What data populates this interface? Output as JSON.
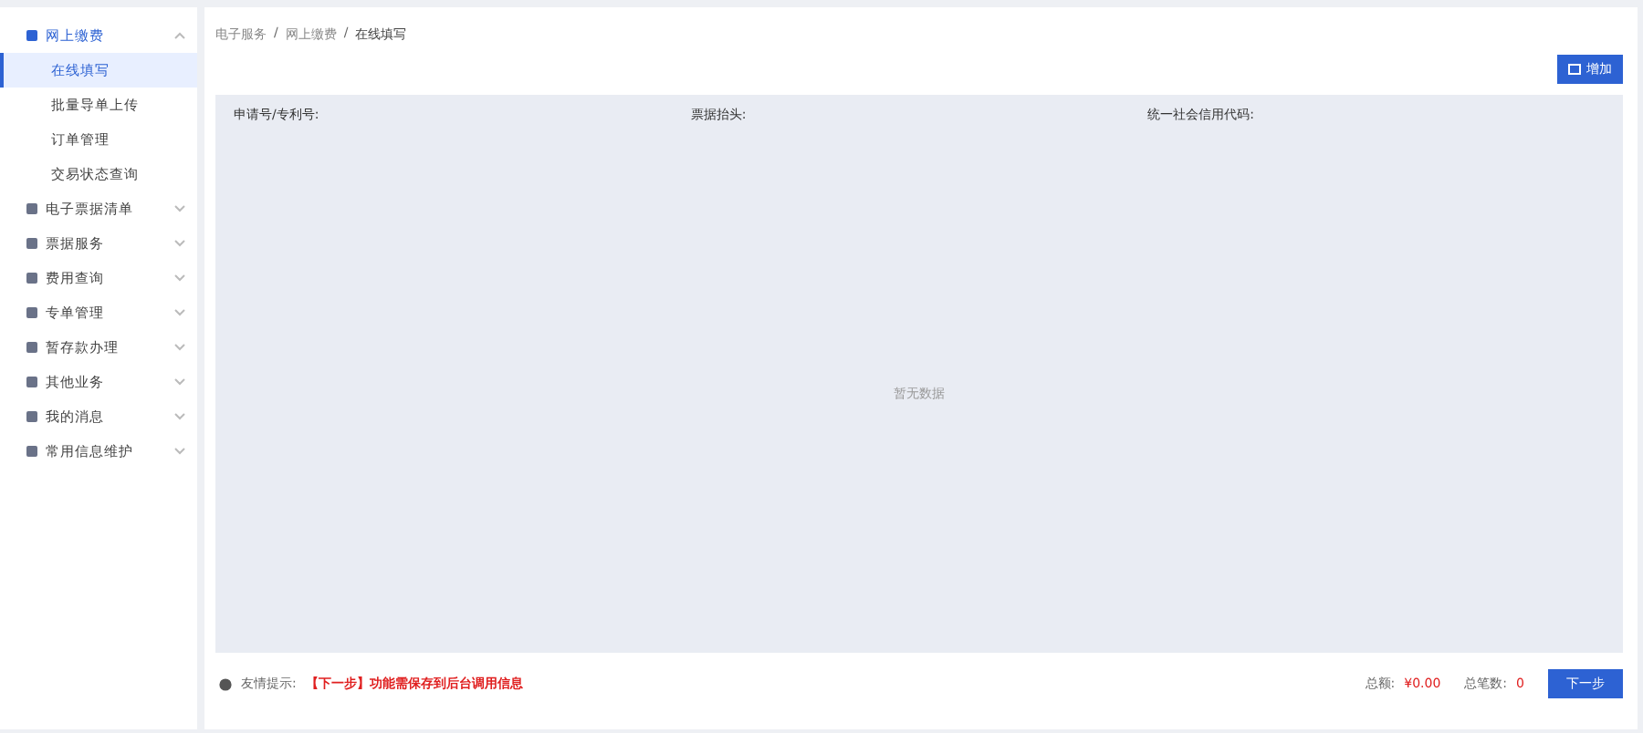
{
  "sidebar": {
    "items": [
      {
        "label": "网上缴费",
        "expanded": true,
        "children": [
          {
            "label": "在线填写",
            "selected": true
          },
          {
            "label": "批量导单上传",
            "selected": false
          },
          {
            "label": "订单管理",
            "selected": false
          },
          {
            "label": "交易状态查询",
            "selected": false
          }
        ]
      },
      {
        "label": "电子票据清单",
        "expanded": false
      },
      {
        "label": "票据服务",
        "expanded": false
      },
      {
        "label": "费用查询",
        "expanded": false
      },
      {
        "label": "专单管理",
        "expanded": false
      },
      {
        "label": "暂存款办理",
        "expanded": false
      },
      {
        "label": "其他业务",
        "expanded": false
      },
      {
        "label": "我的消息",
        "expanded": false
      },
      {
        "label": "常用信息维护",
        "expanded": false
      }
    ]
  },
  "breadcrumb": [
    "电子服务",
    "网上缴费",
    "在线填写"
  ],
  "breadcrumb_separator": "/",
  "add_button": "增加",
  "table": {
    "columns": [
      "申请号/专利号:",
      "票据抬头:",
      "统一社会信用代码:"
    ],
    "empty_text": "暂无数据"
  },
  "footer": {
    "tip_label": "友情提示:",
    "tip_text": "【下一步】功能需保存到后台调用信息",
    "total_label": "总额:",
    "total_value": "¥0.00",
    "count_label": "总笔数:",
    "count_value": "0",
    "next_button": "下一步"
  }
}
